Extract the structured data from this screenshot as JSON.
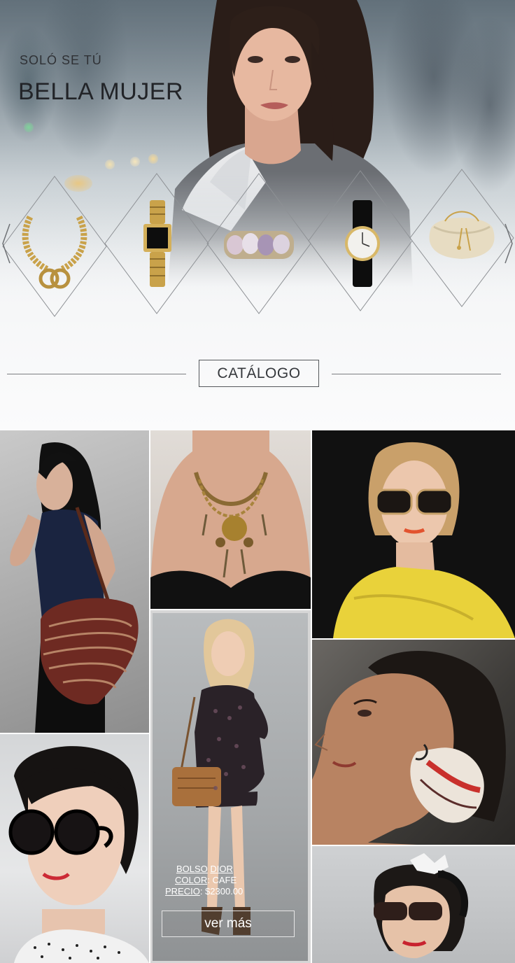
{
  "hero": {
    "tagline_small": "SOLÓ SE TÚ",
    "tagline_big": "BELLA MUJER",
    "products": [
      {
        "name": "chain-necklace"
      },
      {
        "name": "gold-chain-watch"
      },
      {
        "name": "gemstone-bracelet"
      },
      {
        "name": "black-strap-watch"
      },
      {
        "name": "cream-pouch-bag"
      }
    ]
  },
  "catalog": {
    "button_label": "CATÁLOGO"
  },
  "featured": {
    "product_label": "BOLSO",
    "product_value": "DIOR",
    "color_label": "COLOR",
    "color_value": ": CAFE",
    "price_label": "PRECIO",
    "price_value": ": $2300.00",
    "cta_label": "ver más"
  },
  "colors": {
    "text_dark": "#222428",
    "line": "#7b7e82",
    "accent_gold": "#c9a24a"
  }
}
